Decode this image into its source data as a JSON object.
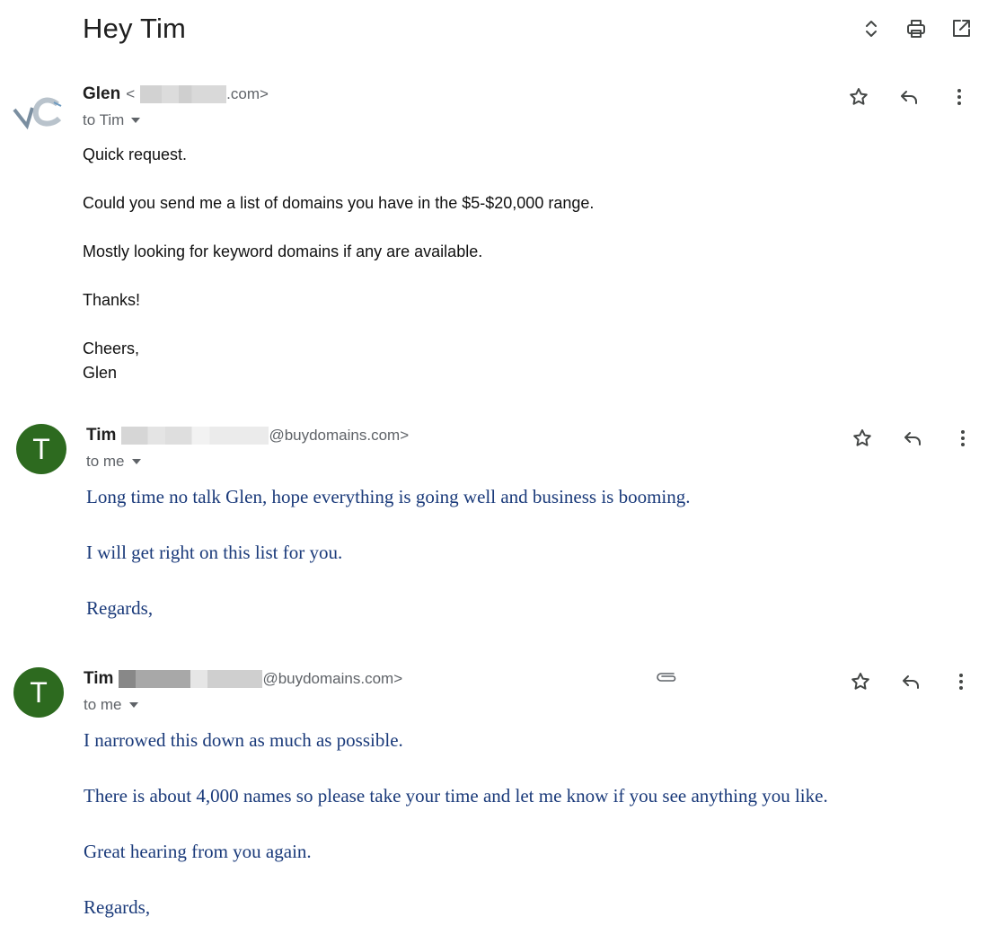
{
  "subject": "Hey Tim",
  "colors": {
    "avatar_bg": "#2d6a1f",
    "reply_text": "#1a3a7a"
  },
  "top_actions": [
    {
      "name": "expand-collapse-icon",
      "label": "Expand all"
    },
    {
      "name": "print-icon",
      "label": "Print all"
    },
    {
      "name": "open-new-window-icon",
      "label": "In new window"
    }
  ],
  "messages": [
    {
      "sender_name": "Glen",
      "email_prefix": "<",
      "email_suffix": ".com>",
      "to": "to Tim",
      "avatar_type": "logo",
      "body": [
        "Quick request.",
        "Could you send me a list of domains you have in the $5-$20,000 range.",
        "Mostly looking for keyword domains if any are available.",
        "Thanks!"
      ],
      "signoff": [
        "Cheers,",
        "Glen"
      ]
    },
    {
      "sender_name": "Tim",
      "email_suffix": "@buydomains.com>",
      "to": "to me",
      "avatar_letter": "T",
      "body": [
        "Long time no talk Glen, hope everything is going well and business is booming.",
        "I will get right on this list for you.",
        "Regards,"
      ]
    },
    {
      "sender_name": "Tim",
      "email_suffix": "@buydomains.com>",
      "to": "to me",
      "avatar_letter": "T",
      "has_attachment": true,
      "body": [
        "I narrowed this down as much as possible.",
        "There is about 4,000 names so please take your time and let me know if you see anything you like.",
        "Great hearing from you again.",
        "Regards,"
      ]
    }
  ]
}
